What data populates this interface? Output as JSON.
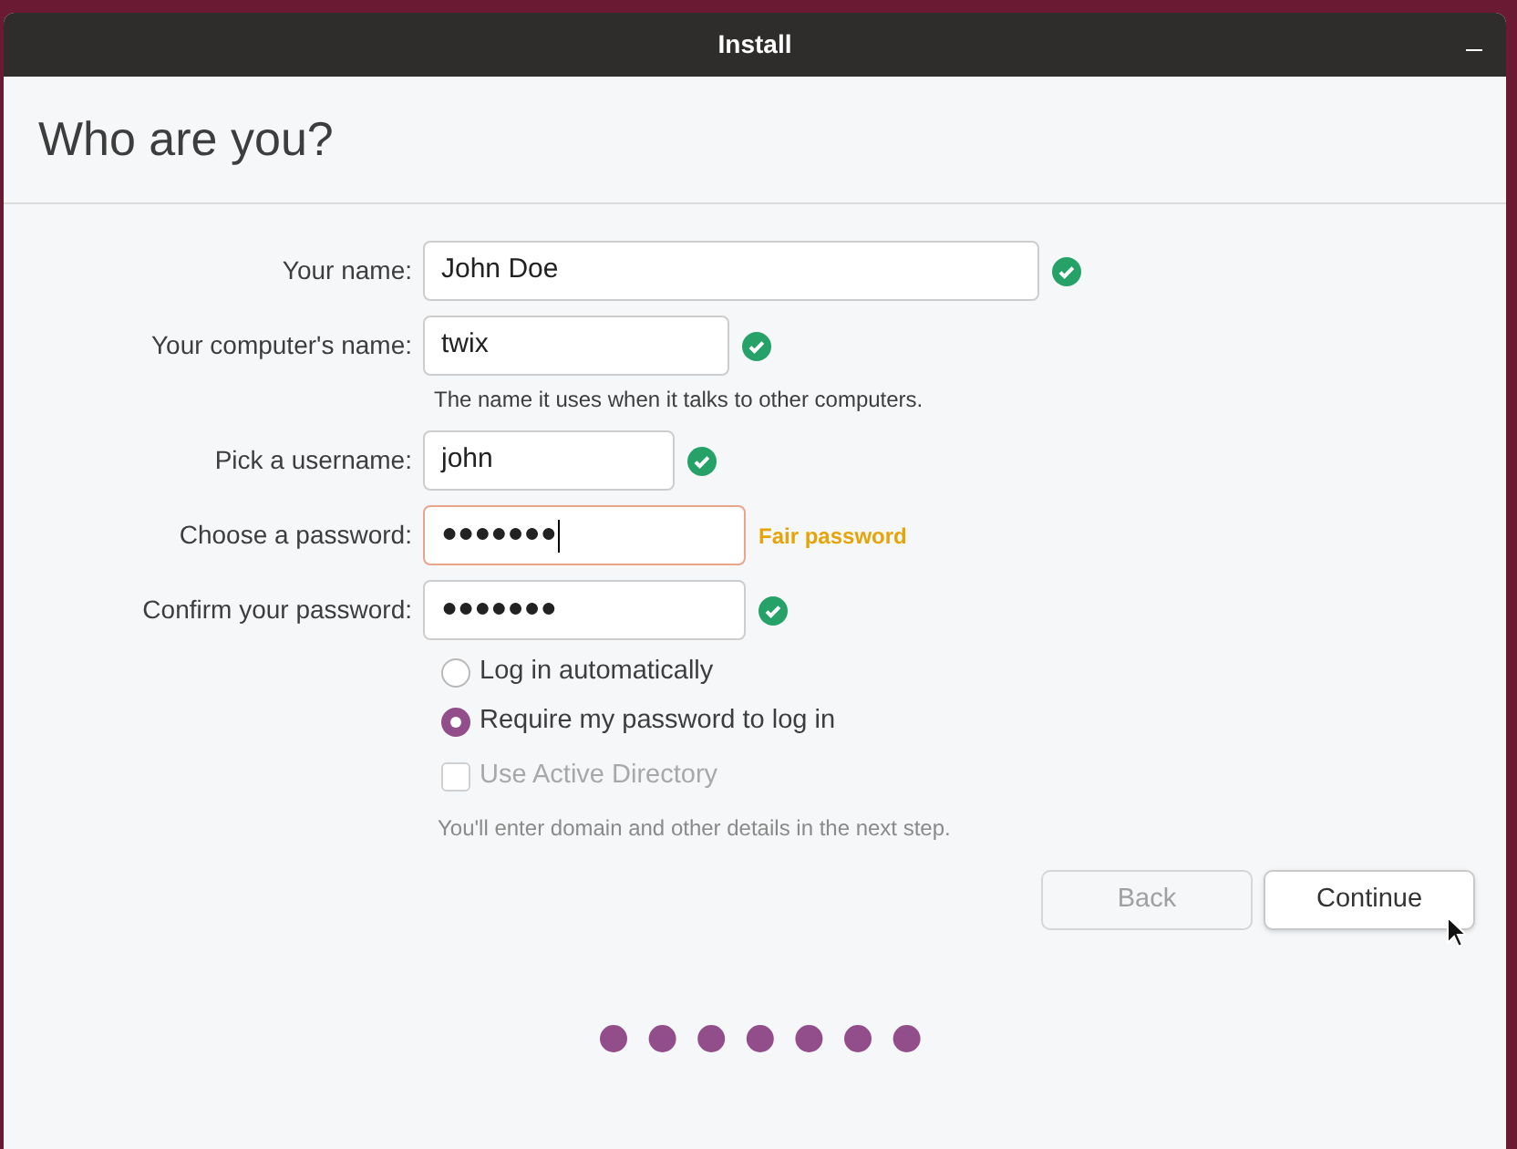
{
  "window": {
    "title": "Install"
  },
  "page_title": "Who are you?",
  "fields": [
    {
      "label": "Your name:",
      "value": "John Doe",
      "valid": true
    },
    {
      "label": "Your computer's name:",
      "value": "twix",
      "valid": true,
      "hint": "The name it uses when it talks to other computers."
    },
    {
      "label": "Pick a username:",
      "value": "john",
      "valid": true
    },
    {
      "label": "Choose a password:",
      "value": "●●●●●●●",
      "valid": false,
      "focused": true,
      "strength": "Fair password"
    },
    {
      "label": "Confirm your password:",
      "value": "●●●●●●●",
      "valid": true
    }
  ],
  "login_options": [
    {
      "label": "Log in automatically",
      "selected": false
    },
    {
      "label": "Require my password to log in",
      "selected": true
    }
  ],
  "active_directory": {
    "label": "Use Active Directory",
    "checked": false,
    "disabled": true,
    "note": "You'll enter domain and other details in the next step."
  },
  "buttons": [
    {
      "label": "Back",
      "disabled": true
    },
    {
      "label": "Continue",
      "disabled": false
    }
  ]
}
